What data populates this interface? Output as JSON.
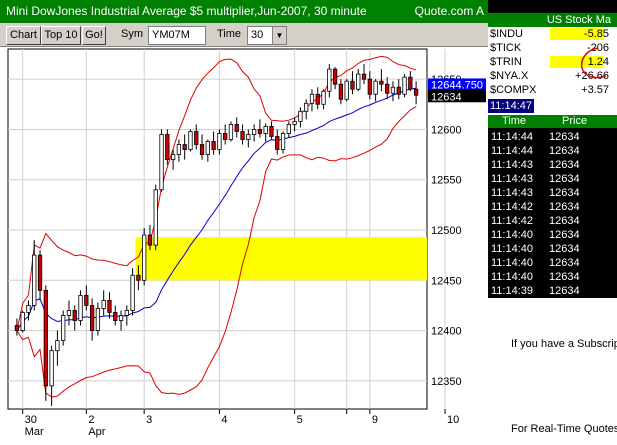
{
  "window": {
    "title": "Mini DowJones Industrial Average $5 multiplier,Jun-2007, 30 minute",
    "title_right": "Quote.com  A"
  },
  "toolbar": {
    "chart_label": "Chart",
    "top10_label": "Top 10",
    "go_label": "Go!",
    "sym_label": "Sym",
    "sym_value": "YM07M",
    "time_label": "Time",
    "time_value": "30"
  },
  "stock_panel": {
    "title": "US Stock Ma",
    "rows": [
      {
        "symbol": "$INDU",
        "value": "-5.85"
      },
      {
        "symbol": "$TICK",
        "value": "-206"
      },
      {
        "symbol": "$TRIN",
        "value": "1.24"
      },
      {
        "symbol": "$NYA.X",
        "value": "+26.66"
      },
      {
        "symbol": "$COMPX",
        "value": "+3.57"
      }
    ],
    "clock": "11:14:47"
  },
  "time_sales": {
    "time_header": "Time",
    "price_header": "Price",
    "rows": [
      {
        "time": "11:14:44",
        "price": "12634"
      },
      {
        "time": "11:14:44",
        "price": "12634"
      },
      {
        "time": "11:14:43",
        "price": "12634"
      },
      {
        "time": "11:14:43",
        "price": "12634"
      },
      {
        "time": "11:14:43",
        "price": "12634"
      },
      {
        "time": "11:14:42",
        "price": "12634"
      },
      {
        "time": "11:14:42",
        "price": "12634"
      },
      {
        "time": "11:14:40",
        "price": "12634"
      },
      {
        "time": "11:14:40",
        "price": "12634"
      },
      {
        "time": "11:14:40",
        "price": "12634"
      },
      {
        "time": "11:14:40",
        "price": "12634"
      },
      {
        "time": "11:14:39",
        "price": "12634"
      }
    ],
    "promo_1": "If you have a Subscript",
    "promo_2": "For Real-Time Quotes"
  },
  "colors": {
    "title_bg": "#008000",
    "up_candle": "#ffffff",
    "down_candle": "#cc0000",
    "bollinger": "#e00000",
    "moving_avg": "#0000cc",
    "highlight_zone": "#ffff00",
    "last_price_tag": "#000000",
    "bid_tag": "#0000ff"
  },
  "chart_data": {
    "type": "candlestick",
    "y_ticks": [
      "12650",
      "12600",
      "12550",
      "12500",
      "12450",
      "12400",
      "12350"
    ],
    "ylim": [
      12322,
      12680
    ],
    "last_price_label": "12634",
    "bid_label": "12644.750",
    "highlight_band": [
      12450,
      12493
    ],
    "x_labels": [
      {
        "day": "30",
        "month": "Mar",
        "bar": 1
      },
      {
        "day": "2",
        "month": "Apr",
        "bar": 12
      },
      {
        "day": "3",
        "month": "",
        "bar": 22
      },
      {
        "day": "4",
        "month": "",
        "bar": 35
      },
      {
        "day": "5",
        "month": "",
        "bar": 48
      },
      {
        "day": "",
        "month": "",
        "bar": 57
      },
      {
        "day": "9",
        "month": "",
        "bar": 61
      },
      {
        "day": "10",
        "month": "",
        "bar": 74
      }
    ],
    "candles": [
      [
        12405,
        12412,
        12395,
        12400
      ],
      [
        12400,
        12420,
        12398,
        12418
      ],
      [
        12418,
        12430,
        12410,
        12425
      ],
      [
        12425,
        12490,
        12420,
        12475
      ],
      [
        12475,
        12480,
        12430,
        12440
      ],
      [
        12440,
        12445,
        12330,
        12345
      ],
      [
        12345,
        12385,
        12325,
        12380
      ],
      [
        12380,
        12400,
        12365,
        12390
      ],
      [
        12390,
        12420,
        12385,
        12415
      ],
      [
        12415,
        12430,
        12405,
        12420
      ],
      [
        12420,
        12425,
        12400,
        12410
      ],
      [
        12410,
        12440,
        12405,
        12435
      ],
      [
        12435,
        12445,
        12420,
        12425
      ],
      [
        12425,
        12432,
        12390,
        12400
      ],
      [
        12400,
        12428,
        12395,
        12422
      ],
      [
        12422,
        12440,
        12415,
        12430
      ],
      [
        12430,
        12438,
        12412,
        12418
      ],
      [
        12418,
        12425,
        12405,
        12410
      ],
      [
        12410,
        12420,
        12400,
        12415
      ],
      [
        12415,
        12425,
        12405,
        12420
      ],
      [
        12420,
        12462,
        12415,
        12455
      ],
      [
        12455,
        12465,
        12440,
        12450
      ],
      [
        12450,
        12502,
        12445,
        12495
      ],
      [
        12495,
        12505,
        12480,
        12485
      ],
      [
        12485,
        12545,
        12480,
        12540
      ],
      [
        12540,
        12600,
        12538,
        12595
      ],
      [
        12595,
        12600,
        12565,
        12570
      ],
      [
        12570,
        12580,
        12560,
        12575
      ],
      [
        12575,
        12590,
        12568,
        12585
      ],
      [
        12585,
        12595,
        12570,
        12580
      ],
      [
        12580,
        12600,
        12578,
        12598
      ],
      [
        12598,
        12605,
        12580,
        12585
      ],
      [
        12585,
        12595,
        12570,
        12575
      ],
      [
        12575,
        12590,
        12568,
        12588
      ],
      [
        12588,
        12598,
        12575,
        12580
      ],
      [
        12580,
        12600,
        12575,
        12596
      ],
      [
        12596,
        12605,
        12585,
        12590
      ],
      [
        12590,
        12608,
        12588,
        12605
      ],
      [
        12605,
        12612,
        12592,
        12598
      ],
      [
        12598,
        12605,
        12585,
        12590
      ],
      [
        12590,
        12600,
        12582,
        12595
      ],
      [
        12595,
        12605,
        12588,
        12600
      ],
      [
        12600,
        12610,
        12592,
        12596
      ],
      [
        12596,
        12606,
        12588,
        12603
      ],
      [
        12603,
        12608,
        12590,
        12593
      ],
      [
        12593,
        12600,
        12575,
        12580
      ],
      [
        12580,
        12598,
        12576,
        12596
      ],
      [
        12596,
        12608,
        12592,
        12605
      ],
      [
        12605,
        12612,
        12598,
        12608
      ],
      [
        12608,
        12622,
        12602,
        12618
      ],
      [
        12618,
        12630,
        12610,
        12626
      ],
      [
        12626,
        12640,
        12618,
        12635
      ],
      [
        12635,
        12642,
        12620,
        12625
      ],
      [
        12625,
        12640,
        12620,
        12638
      ],
      [
        12638,
        12665,
        12632,
        12660
      ],
      [
        12660,
        12662,
        12640,
        12645
      ],
      [
        12645,
        12650,
        12625,
        12630
      ],
      [
        12630,
        12650,
        12628,
        12648
      ],
      [
        12648,
        12658,
        12635,
        12640
      ],
      [
        12640,
        12660,
        12638,
        12655
      ],
      [
        12655,
        12665,
        12645,
        12650
      ],
      [
        12650,
        12658,
        12630,
        12635
      ],
      [
        12635,
        12650,
        12628,
        12648
      ],
      [
        12648,
        12660,
        12638,
        12645
      ],
      [
        12645,
        12652,
        12630,
        12636
      ],
      [
        12636,
        12648,
        12628,
        12642
      ],
      [
        12642,
        12650,
        12630,
        12635
      ],
      [
        12635,
        12655,
        12632,
        12652
      ],
      [
        12652,
        12658,
        12638,
        12640
      ],
      [
        12640,
        12648,
        12625,
        12634
      ]
    ]
  }
}
